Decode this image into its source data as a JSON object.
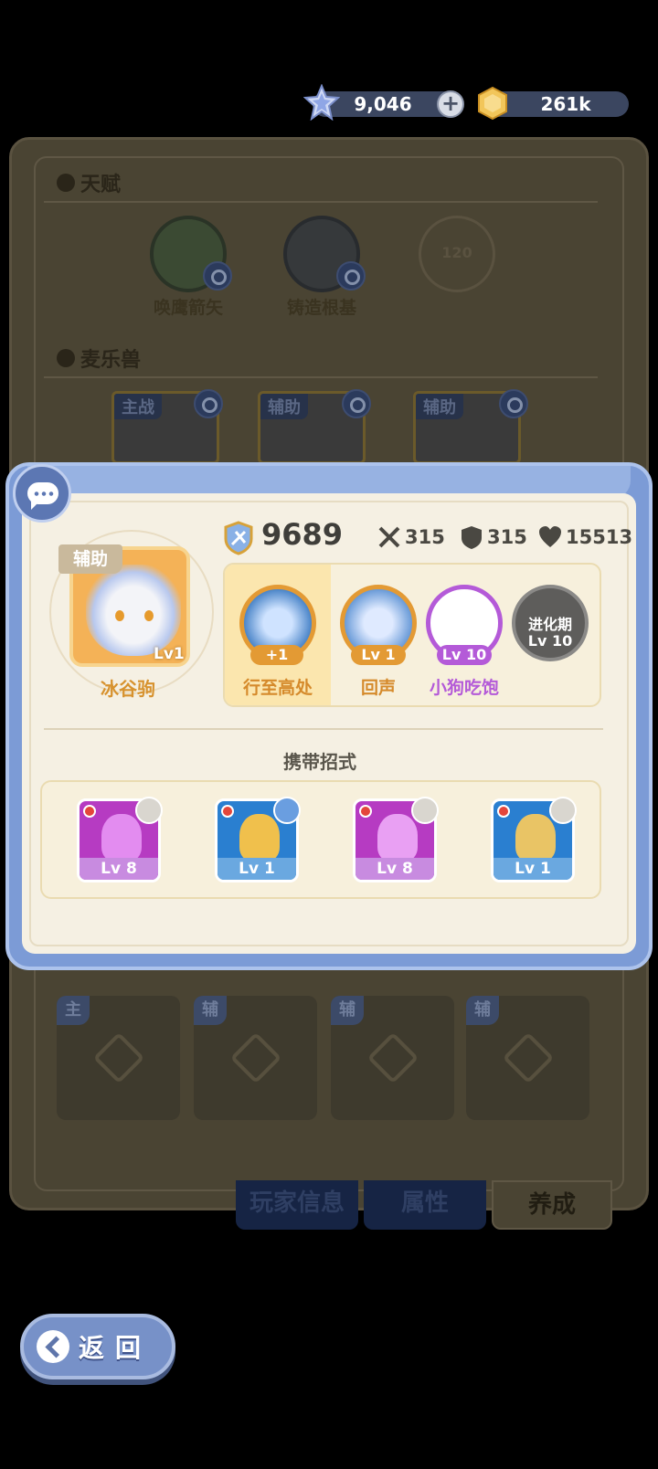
{
  "currency": {
    "gems": "9,046",
    "coins": "261k",
    "plus_label": "+"
  },
  "background": {
    "talent_title": "天赋",
    "talents": [
      {
        "label": "唤鹰箭矢"
      },
      {
        "label": "铸造根基"
      },
      {
        "label": "120"
      }
    ],
    "beast_title": "麦乐兽",
    "beast_cards": [
      {
        "tag": "主战"
      },
      {
        "tag": "辅助"
      },
      {
        "tag": "辅助"
      }
    ],
    "slots": [
      "主",
      "辅",
      "辅",
      "辅"
    ],
    "tabs": {
      "info": "玩家信息",
      "attr": "属性",
      "grow": "养成"
    }
  },
  "popup": {
    "role_tag": "辅助",
    "level": "Lv1",
    "beast_name": "冰谷驹",
    "power": "9689",
    "stats": {
      "attack": "315",
      "defense": "315",
      "hp": "15513"
    },
    "skills": [
      {
        "label": "行至高处",
        "badge": "+1",
        "color": "#e39a34"
      },
      {
        "label": "回声",
        "badge": "Lv 1",
        "color": "#e39a34"
      },
      {
        "label": "小狗吃饱",
        "badge": "Lv 10",
        "color": "#b45ad8"
      },
      {
        "label_top": "进化期",
        "label_bottom": "Lv 10",
        "locked": true
      }
    ],
    "moves_title": "携带招式",
    "moves": [
      {
        "level": "Lv 8",
        "type_icon": "cross-swords-icon",
        "color": "#b63bc2"
      },
      {
        "level": "Lv 1",
        "type_icon": "shield-icon",
        "color": "#2a7fd0"
      },
      {
        "level": "Lv 8",
        "type_icon": "link-icon",
        "color": "#b63bc2"
      },
      {
        "level": "Lv 1",
        "type_icon": "link-icon",
        "color": "#2a7fd0"
      }
    ]
  },
  "back_button": {
    "label": "返回"
  }
}
